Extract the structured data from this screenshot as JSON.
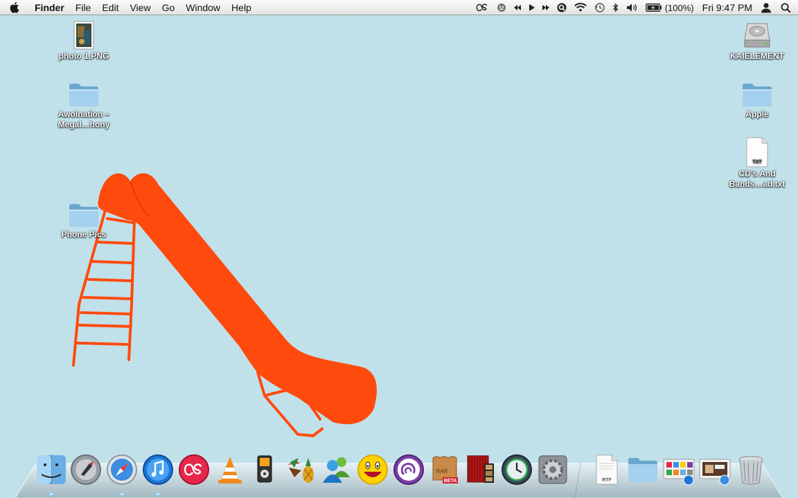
{
  "menubar": {
    "app_name": "Finder",
    "items": [
      "File",
      "Edit",
      "View",
      "Go",
      "Window",
      "Help"
    ],
    "status": {
      "battery": "(100%)",
      "clock": "Fri 9:47 PM"
    }
  },
  "desktop": {
    "left_icons": [
      {
        "label": "photo 1.PNG",
        "icon": "image-file-icon"
      },
      {
        "label": "Awolnation – Megal…hony",
        "icon": "folder-icon"
      },
      {
        "label": "Phone Pics",
        "icon": "folder-icon"
      }
    ],
    "right_icons": [
      {
        "label": "KAIELEMENT",
        "icon": "hard-drive-icon"
      },
      {
        "label": "Apple",
        "icon": "folder-icon"
      },
      {
        "label": "CD's And Bands…ad.txt",
        "icon": "text-file-icon",
        "badge": "TXT"
      }
    ]
  },
  "dock": {
    "apps": [
      {
        "name": "Finder",
        "icon": "finder-icon",
        "running": true
      },
      {
        "name": "Launchpad",
        "icon": "launchpad-icon",
        "running": false
      },
      {
        "name": "Safari",
        "icon": "safari-icon",
        "running": true
      },
      {
        "name": "iTunes",
        "icon": "itunes-icon",
        "running": true
      },
      {
        "name": "Last.fm",
        "icon": "lastfm-icon",
        "running": false
      },
      {
        "name": "VLC",
        "icon": "vlc-icon",
        "running": false
      },
      {
        "name": "iPod utility",
        "icon": "ipod-icon",
        "running": false
      },
      {
        "name": "Adium",
        "icon": "adium-icon",
        "running": false
      },
      {
        "name": "Messenger",
        "icon": "messenger-icon",
        "running": false
      },
      {
        "name": "Yahoo Messenger",
        "icon": "yahoo-icon",
        "running": false
      },
      {
        "name": "BitTorrent",
        "icon": "bittorrent-icon",
        "running": false
      },
      {
        "name": "RAR",
        "icon": "rar-icon",
        "running": false
      },
      {
        "name": "Photo Booth",
        "icon": "photobooth-icon",
        "running": false
      },
      {
        "name": "Time Machine",
        "icon": "timemachine-icon",
        "running": false
      },
      {
        "name": "System Preferences",
        "icon": "sysprefs-icon",
        "running": false
      },
      {
        "name": "RTF document",
        "icon": "rtf-icon",
        "running": false,
        "badge": "RTF"
      },
      {
        "name": "Documents",
        "icon": "folder-stack-icon",
        "running": false
      },
      {
        "name": "Applications",
        "icon": "apps-stack-icon",
        "running": false
      },
      {
        "name": "Downloads",
        "icon": "downloads-stack-icon",
        "running": false
      },
      {
        "name": "Trash",
        "icon": "trash-icon",
        "running": false
      }
    ],
    "rar_badge": "BETA",
    "rar_text": "RAR"
  },
  "colors": {
    "desktop": "#c0e1ea",
    "slide": "#ff4a0d"
  }
}
